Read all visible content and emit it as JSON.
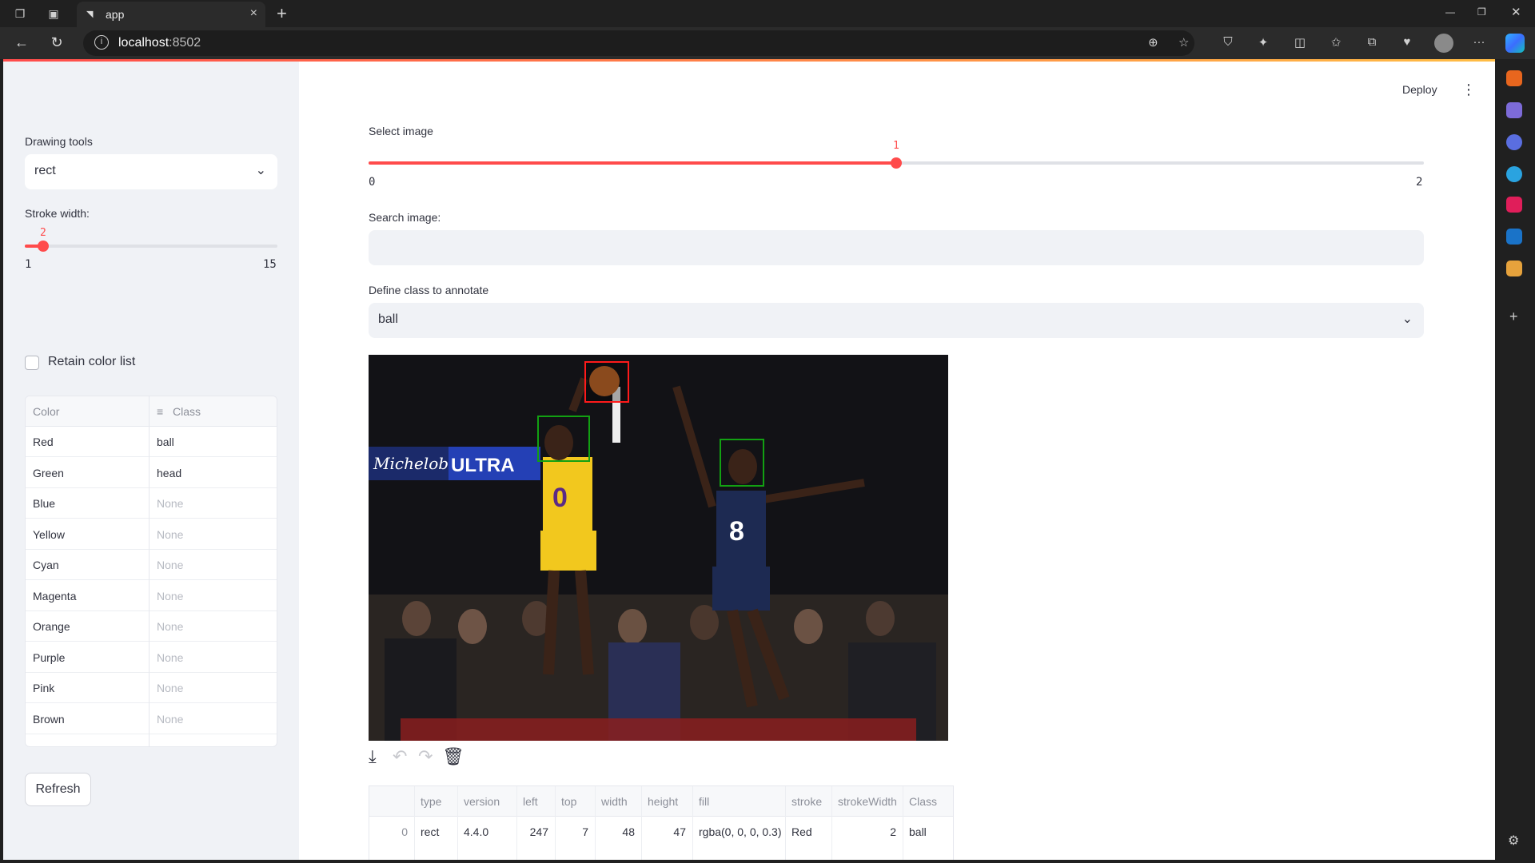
{
  "browser": {
    "tab_title": "app",
    "url_host": "localhost",
    "url_port": ":8502"
  },
  "header": {
    "deploy_label": "Deploy"
  },
  "sidebar": {
    "drawing_tools_label": "Drawing tools",
    "drawing_tool_value": "rect",
    "stroke_width_label": "Stroke width:",
    "stroke_width": {
      "value": "2",
      "min": "1",
      "max": "15",
      "fraction": 0.0714
    },
    "retain_label": "Retain color list",
    "table_headers": [
      "Color",
      "Class"
    ],
    "rows": [
      {
        "color": "Red",
        "class": "ball"
      },
      {
        "color": "Green",
        "class": "head"
      },
      {
        "color": "Blue",
        "class": "None"
      },
      {
        "color": "Yellow",
        "class": "None"
      },
      {
        "color": "Cyan",
        "class": "None"
      },
      {
        "color": "Magenta",
        "class": "None"
      },
      {
        "color": "Orange",
        "class": "None"
      },
      {
        "color": "Purple",
        "class": "None"
      },
      {
        "color": "Pink",
        "class": "None"
      },
      {
        "color": "Brown",
        "class": "None"
      }
    ],
    "refresh_label": "Refresh"
  },
  "main": {
    "select_image_label": "Select image",
    "image_slider": {
      "value": "1",
      "min": "0",
      "max": "2",
      "fraction": 0.5
    },
    "search_label": "Search image:",
    "search_value": "",
    "class_label": "Define class to annotate",
    "class_value": "ball",
    "image_text": {
      "banner_left": "Michelob",
      "banner_right": "ULTRA",
      "jersey_1": "0",
      "jersey_2": "8"
    },
    "output_table": {
      "headers": [
        "",
        "type",
        "version",
        "left",
        "top",
        "width",
        "height",
        "fill",
        "stroke",
        "strokeWidth",
        "Class"
      ],
      "rows": [
        [
          "0",
          "rect",
          "4.4.0",
          "247",
          "7",
          "48",
          "47",
          "rgba(0, 0, 0, 0.3)",
          "Red",
          "2",
          "ball"
        ]
      ]
    }
  },
  "colors": {
    "accent": "#ff4b4b",
    "sidebar_bg": "#f0f2f6",
    "text": "#31333f"
  }
}
